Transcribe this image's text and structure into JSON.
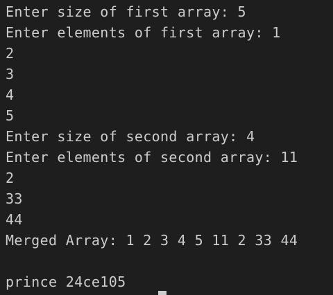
{
  "terminal": {
    "lines": [
      "Enter size of first array: 5",
      "Enter elements of first array: 1",
      "2",
      "3",
      "4",
      "5",
      "Enter size of second array: 4",
      "Enter elements of second array: 11",
      "2",
      "33",
      "44",
      "Merged Array: 1 2 3 4 5 11 2 33 44",
      "",
      "prince 24ce105"
    ]
  },
  "colors": {
    "background": "#1e1e1e",
    "text": "#cccccc",
    "cursor": "#cccccc"
  }
}
